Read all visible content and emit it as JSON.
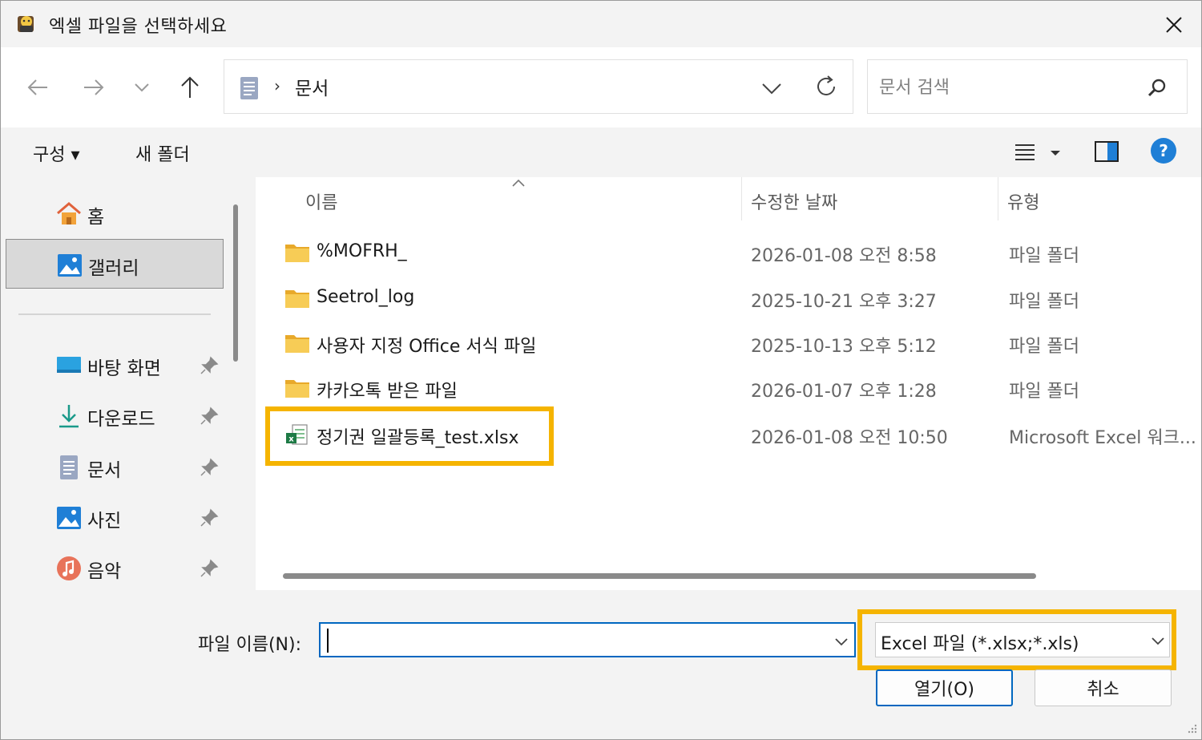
{
  "window": {
    "title": "엑셀 파일을 선택하세요"
  },
  "nav": {
    "address_path": "문서",
    "address_separator": "›",
    "search_placeholder": "문서 검색"
  },
  "toolbar": {
    "organize_label": "구성 ▾",
    "new_folder_label": "새 폴더"
  },
  "navpane": {
    "items": [
      {
        "label": "홈",
        "icon": "home-icon",
        "pinned": false,
        "selected": false
      },
      {
        "label": "갤러리",
        "icon": "gallery-icon",
        "pinned": false,
        "selected": true
      },
      {
        "label": "바탕 화면",
        "icon": "desktop-icon",
        "pinned": true,
        "selected": false
      },
      {
        "label": "다운로드",
        "icon": "download-icon",
        "pinned": true,
        "selected": false
      },
      {
        "label": "문서",
        "icon": "document-icon",
        "pinned": true,
        "selected": false
      },
      {
        "label": "사진",
        "icon": "pictures-icon",
        "pinned": true,
        "selected": false
      },
      {
        "label": "음악",
        "icon": "music-icon",
        "pinned": true,
        "selected": false
      }
    ]
  },
  "filelist": {
    "columns": {
      "name": "이름",
      "date": "수정한 날짜",
      "type": "유형"
    },
    "rows": [
      {
        "name": "%MOFRH_",
        "date": "2026-01-08 오전 8:58",
        "type": "파일 폴더",
        "icon": "folder-icon"
      },
      {
        "name": "Seetrol_log",
        "date": "2025-10-21 오후 3:27",
        "type": "파일 폴더",
        "icon": "folder-icon"
      },
      {
        "name": "사용자 지정 Office 서식 파일",
        "date": "2025-10-13 오후 5:12",
        "type": "파일 폴더",
        "icon": "folder-icon"
      },
      {
        "name": "카카오톡 받은 파일",
        "date": "2026-01-07 오후 1:28",
        "type": "파일 폴더",
        "icon": "folder-icon"
      },
      {
        "name": "정기권 일괄등록_test.xlsx",
        "date": "2026-01-08 오전 10:50",
        "type": "Microsoft Excel 워크...",
        "icon": "excel-file-icon"
      }
    ]
  },
  "bottom": {
    "filename_label": "파일 이름(N):",
    "filename_value": "",
    "filetype_value": "Excel 파일 (*.xlsx;*.xls)",
    "open_label": "열기(O)",
    "cancel_label": "취소"
  },
  "colors": {
    "highlight": "#f5b400",
    "accent": "#0067c0",
    "folder": "#f4c54a"
  }
}
